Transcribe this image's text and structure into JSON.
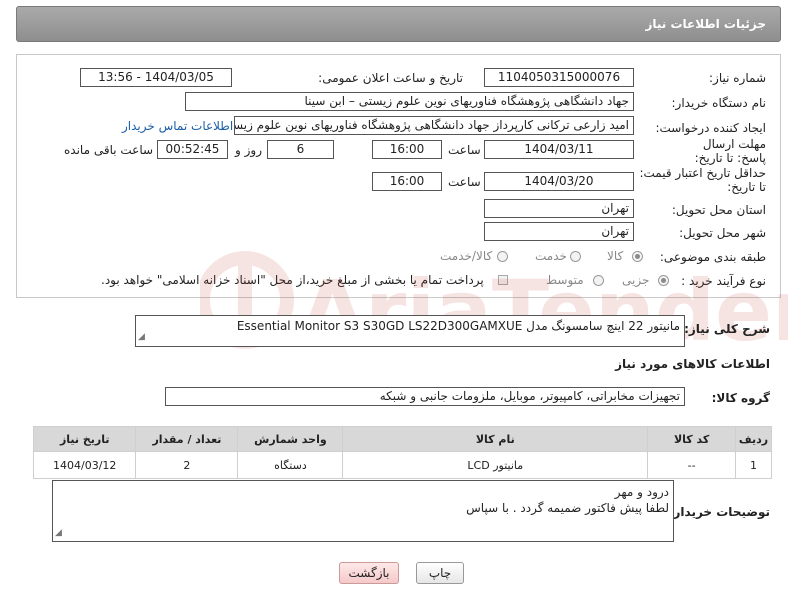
{
  "header": {
    "title": "جزئیات اطلاعات نیاز"
  },
  "form": {
    "need_number_label": "شماره نیاز:",
    "need_number": "1104050315000076",
    "announce_label": "تاریخ و ساعت اعلان عمومی:",
    "announce_value": "1404/03/05 - 13:56",
    "buyer_label": "نام دستگاه خریدار:",
    "buyer_value": "جهاد دانشگاهی پژوهشگاه فناوریهای نوین علوم زیستی – ابن سینا",
    "creator_label": "ایجاد کننده درخواست:",
    "creator_value": "امید  زارعی ترکانی  کارپرداز جهاد دانشگاهی پژوهشگاه فناوریهای نوین علوم زیستی",
    "contact_link": "اطلاعات تماس خریدار",
    "deadline_label": "مهلت ارسال پاسخ: تا تاریخ:",
    "deadline_date": "1404/03/11",
    "time_label": "ساعت",
    "deadline_time": "16:00",
    "days_value": "6",
    "days_label": "روز و",
    "remaining_value": "00:52:45",
    "remaining_label": "ساعت باقی مانده",
    "validity_label": "حداقل تاریخ اعتبار قیمت: تا تاریخ:",
    "validity_date": "1404/03/20",
    "validity_time": "16:00",
    "province_label": "استان محل تحویل:",
    "province_value": "تهران",
    "city_label": "شهر محل تحویل:",
    "city_value": "تهران",
    "category_label": "طبقه بندی موضوعی:",
    "category_options": [
      "کالا",
      "خدمت",
      "کالا/خدمت"
    ],
    "process_label": "نوع فرآیند خرید :",
    "process_options": [
      "جزیی",
      "متوسط"
    ],
    "payment_note": "پرداخت تمام یا بخشی از مبلغ خرید،از محل \"اسناد خزانه اسلامی\" خواهد بود."
  },
  "description": {
    "label": "شرح کلی نیاز:",
    "value": "مانیتور 22 اینچ سامسونگ مدل Essential Monitor S3 S30GD LS22D300GAMXUE"
  },
  "goods_section_title": "اطلاعات کالاهای مورد نیاز",
  "goods_group": {
    "label": "گروه کالا:",
    "value": "تجهیزات مخابراتی، کامپیوتر، موبایل، ملزومات جانبی و شبکه"
  },
  "table": {
    "headers": [
      "ردیف",
      "کد کالا",
      "نام کالا",
      "واحد شمارش",
      "تعداد / مقدار",
      "تاریخ نیاز"
    ],
    "rows": [
      [
        "1",
        "--",
        "مانیتور LCD",
        "دستگاه",
        "2",
        "1404/03/12"
      ]
    ]
  },
  "buyer_notes": {
    "label": "توضیحات خریدار:",
    "line1": "درود و مهر",
    "line2": "لطفا پیش فاکتور ضمیمه گردد . با سپاس"
  },
  "buttons": {
    "print": "چاپ",
    "back": "بازگشت"
  },
  "watermark": {
    "text": "AriaTender.neT"
  },
  "colors": {
    "header": "#9b9b9b",
    "link": "#1a5fa8",
    "watermark": "#c0392b"
  }
}
